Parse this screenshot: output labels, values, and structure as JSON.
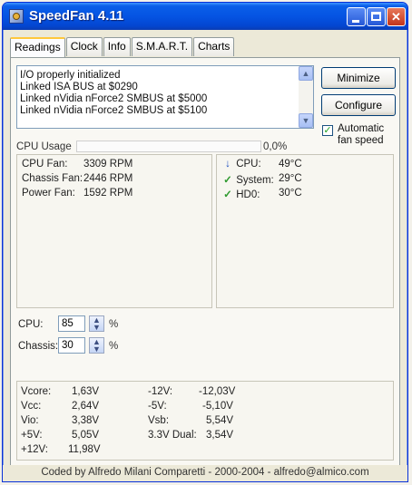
{
  "window": {
    "title": "SpeedFan 4.11"
  },
  "tabs": [
    {
      "label": "Readings",
      "active": true
    },
    {
      "label": "Clock"
    },
    {
      "label": "Info"
    },
    {
      "label": "S.M.A.R.T."
    },
    {
      "label": "Charts"
    }
  ],
  "log": {
    "lines": [
      "I/O properly initialized",
      "Linked ISA BUS at $0290",
      "Linked nVidia nForce2 SMBUS at $5000",
      "Linked nVidia nForce2 SMBUS at $5100"
    ]
  },
  "buttons": {
    "minimize": "Minimize",
    "configure": "Configure"
  },
  "auto_fan": {
    "label": "Automatic fan speed",
    "checked": true
  },
  "cpu_usage": {
    "label": "CPU Usage",
    "value": "0,0%",
    "fraction": 0.0
  },
  "fans": [
    {
      "name": "CPU Fan:",
      "value": "3309 RPM"
    },
    {
      "name": "Chassis Fan:",
      "value": "2446 RPM"
    },
    {
      "name": "Power Fan:",
      "value": "1592 RPM"
    }
  ],
  "temps": [
    {
      "icon": "arrow-down-icon",
      "name": "CPU:",
      "value": "49°C"
    },
    {
      "icon": "check-icon",
      "name": "System:",
      "value": "29°C"
    },
    {
      "icon": "check-icon",
      "name": "HD0:",
      "value": "30°C"
    }
  ],
  "speeds": [
    {
      "label": "CPU:",
      "value": "85",
      "unit": "%"
    },
    {
      "label": "Chassis:",
      "value": "30",
      "unit": "%"
    }
  ],
  "voltages_left": [
    {
      "name": "Vcore:",
      "value": "1,63V"
    },
    {
      "name": "Vcc:",
      "value": "2,64V"
    },
    {
      "name": "Vio:",
      "value": "3,38V"
    },
    {
      "name": "+5V:",
      "value": "5,05V"
    },
    {
      "name": "+12V:",
      "value": "11,98V"
    }
  ],
  "voltages_right": [
    {
      "name": "-12V:",
      "value": "-12,03V"
    },
    {
      "name": "-5V:",
      "value": "-5,10V"
    },
    {
      "name": "Vsb:",
      "value": "5,54V"
    },
    {
      "name": "3.3V Dual:",
      "value": "3,54V"
    }
  ],
  "footer": "Coded by Alfredo Milani Comparetti - 2000-2004 - alfredo@almico.com",
  "colors": {
    "titlebar": "#0554e3",
    "window_bg": "#ece9d8",
    "check": "#2f9a2f",
    "arrow": "#1f4fbf"
  }
}
